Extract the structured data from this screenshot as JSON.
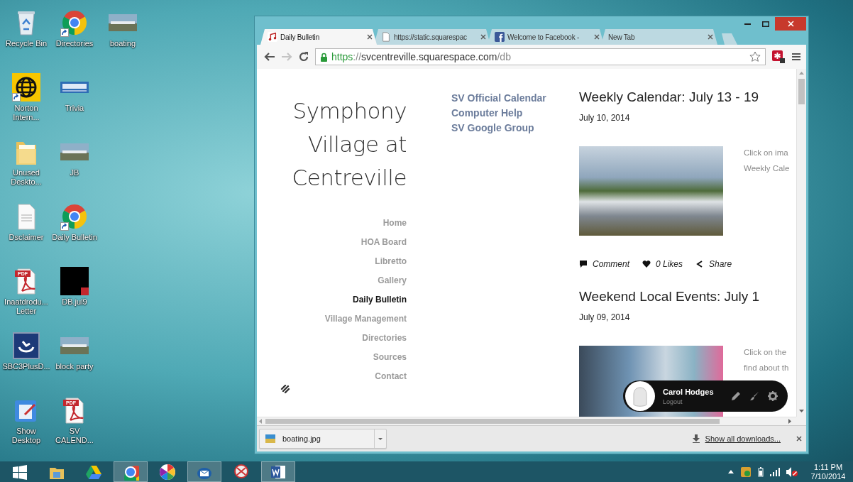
{
  "desktop": {
    "icon_rows": [
      [
        {
          "label": "Recycle Bin",
          "kind": "recycle",
          "shortcut": false
        },
        {
          "label": "Directories",
          "kind": "chrome",
          "shortcut": true
        },
        {
          "label": "boating",
          "kind": "photo",
          "shortcut": false
        }
      ],
      [
        {
          "label": "Norton Intern...",
          "kind": "norton",
          "shortcut": true
        },
        {
          "label": "Trivia",
          "kind": "banner",
          "shortcut": false
        }
      ],
      [
        {
          "label": "Unused Deskto...",
          "kind": "folder",
          "shortcut": false
        },
        {
          "label": "JB",
          "kind": "photo",
          "shortcut": false
        }
      ],
      [
        {
          "label": "Dsclaimer",
          "kind": "document",
          "shortcut": false
        },
        {
          "label": "Daily Bulletin",
          "kind": "chrome",
          "shortcut": true
        }
      ],
      [
        {
          "label": "Inaatdrodu... Letter",
          "kind": "pdf",
          "badge": "PDF",
          "shortcut": false
        },
        {
          "label": "DB.jul9",
          "kind": "pdf-thumb",
          "shortcut": false
        }
      ],
      [
        {
          "label": "SBC3PlusD...",
          "kind": "app",
          "shortcut": false
        },
        {
          "label": "block party",
          "kind": "photo",
          "shortcut": false
        }
      ],
      [
        {
          "label": "Show Desktop",
          "kind": "show-desktop",
          "shortcut": false
        },
        {
          "label": "SV CALEND...",
          "kind": "pdf",
          "badge": "PDF",
          "shortcut": false
        }
      ]
    ]
  },
  "browser": {
    "tabs": [
      {
        "title": "Daily Bulletin",
        "kind": "music",
        "selected": true
      },
      {
        "title": "https://static.squarespac",
        "kind": "page",
        "selected": false
      },
      {
        "title": "Welcome to Facebook -",
        "kind": "facebook",
        "selected": false
      },
      {
        "title": "New Tab",
        "kind": "blank",
        "selected": false
      }
    ],
    "nav_buttons": [
      {
        "kind": "back",
        "disabled": false
      },
      {
        "kind": "forward",
        "disabled": true
      },
      {
        "kind": "reload",
        "disabled": false
      }
    ],
    "url": {
      "scheme": "https",
      "separator": "://",
      "host": "svcentreville.squarespace.com",
      "path": "/db"
    },
    "page": {
      "site_title": [
        "Symphony",
        "Village at",
        "Centreville"
      ],
      "nav": [
        {
          "label": "Home",
          "selected": false
        },
        {
          "label": "HOA Board",
          "selected": false
        },
        {
          "label": "Libretto",
          "selected": false
        },
        {
          "label": "Gallery",
          "selected": false
        },
        {
          "label": "Daily Bulletin",
          "selected": true
        },
        {
          "label": "Village Management",
          "selected": false
        },
        {
          "label": "Directories",
          "selected": false
        },
        {
          "label": "Sources",
          "selected": false
        },
        {
          "label": "Contact",
          "selected": false
        }
      ],
      "links": [
        "SV Official Calendar",
        "Computer Help",
        "SV Google Group"
      ],
      "posts": [
        {
          "title": "Weekly Calendar: July 13 - 19",
          "date": "July 10, 2014",
          "excerpt": [
            "Click on ima",
            "Weekly Cale"
          ],
          "actions": [
            {
              "kind": "comment",
              "label": "Comment"
            },
            {
              "kind": "like",
              "label": "0 Likes"
            },
            {
              "kind": "share",
              "label": "Share"
            }
          ]
        },
        {
          "title": "Weekend Local Events: July 1",
          "date": "July 09, 2014",
          "excerpt": [
            "Click on the",
            "find about th"
          ]
        }
      ],
      "user_panel": {
        "name": "Carol Hodges",
        "action": "Logout"
      }
    },
    "downloads": {
      "items": [
        {
          "name": "boating.jpg"
        }
      ],
      "show_all": "Show all downloads..."
    }
  },
  "taskbar": {
    "apps": [
      {
        "kind": "start",
        "active": false
      },
      {
        "kind": "explorer",
        "active": false
      },
      {
        "kind": "drive",
        "active": false
      },
      {
        "kind": "chrome",
        "active": true
      },
      {
        "kind": "picasa",
        "active": false
      },
      {
        "kind": "mail",
        "active": true
      },
      {
        "kind": "snipping",
        "active": false
      },
      {
        "kind": "word",
        "active": true
      }
    ],
    "clock": {
      "time": "1:11 PM",
      "date": "7/10/2014"
    }
  }
}
